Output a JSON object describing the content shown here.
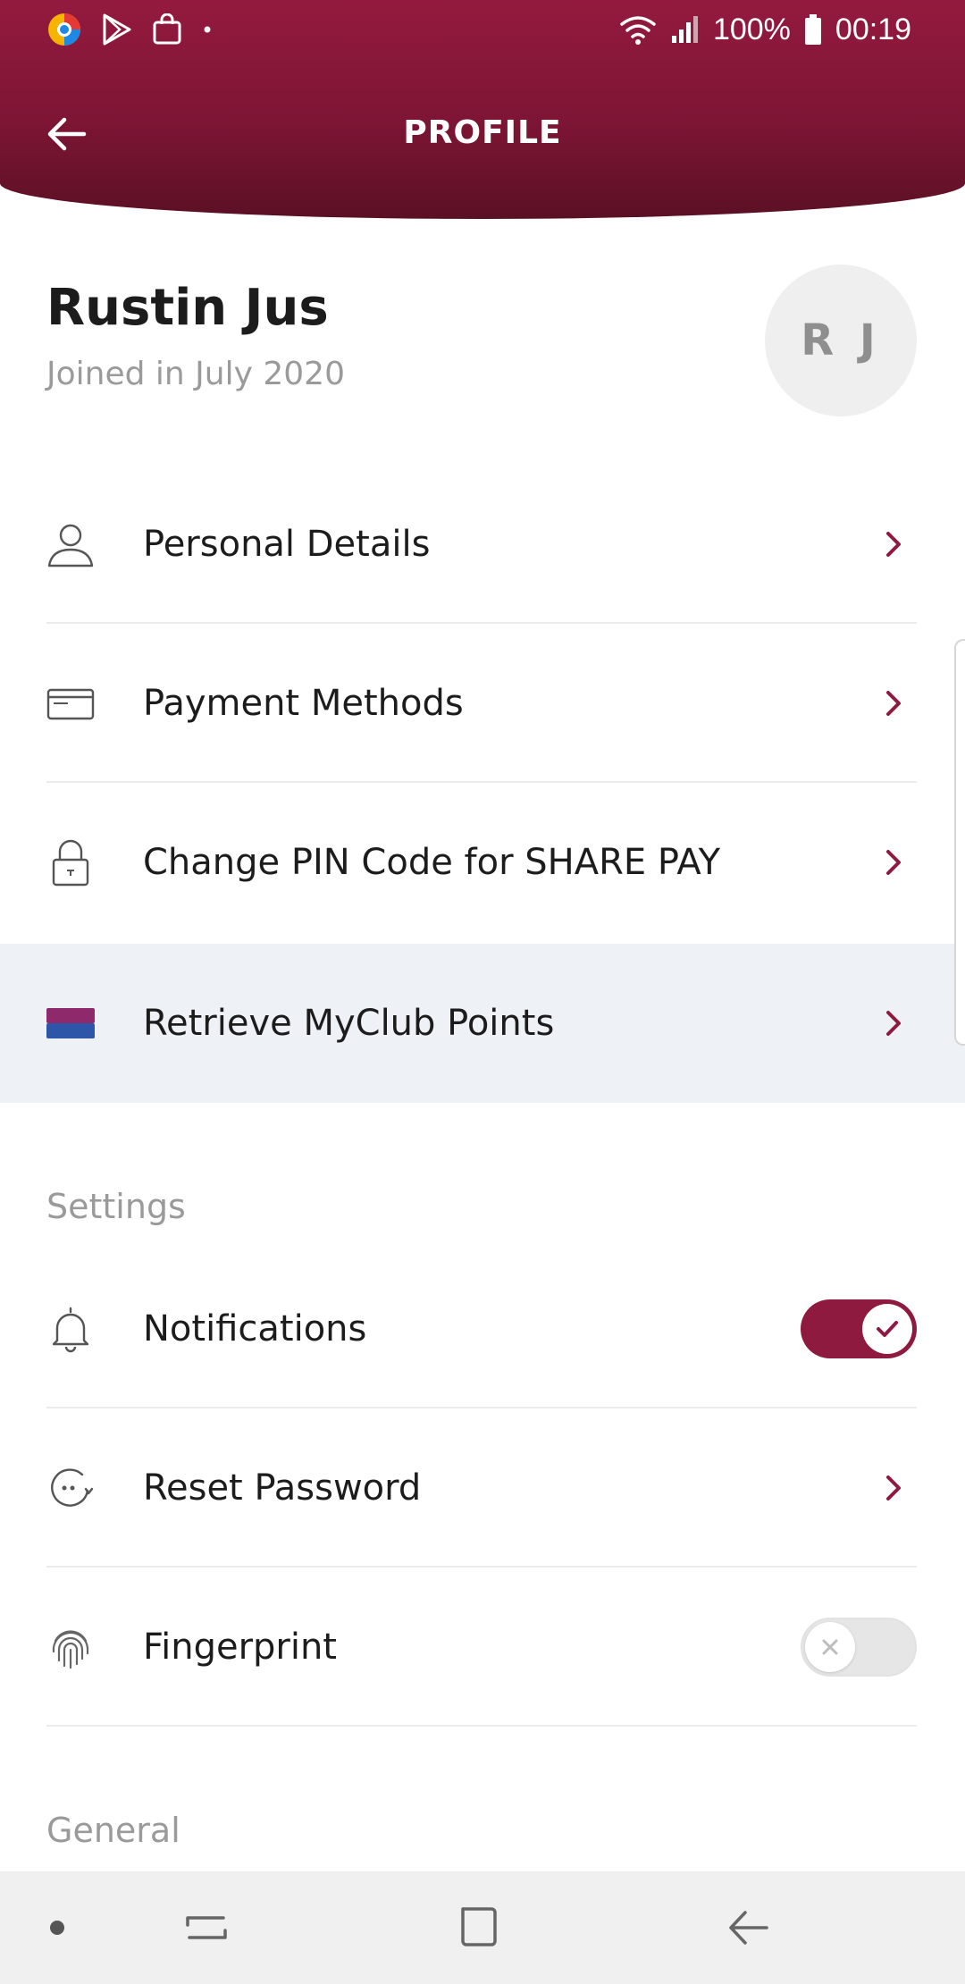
{
  "status_bar": {
    "battery_percent": "100%",
    "time": "00:19"
  },
  "header": {
    "title": "PROFILE"
  },
  "profile": {
    "name": "Rustin Jus",
    "joined": "Joined in July 2020",
    "initials": "R J"
  },
  "account_items": [
    {
      "label": "Personal Details",
      "icon": "person-icon"
    },
    {
      "label": "Payment Methods",
      "icon": "credit-card-icon"
    },
    {
      "label": "Change PIN Code for SHARE PAY",
      "icon": "lock-icon"
    },
    {
      "label": "Retrieve MyClub Points",
      "icon": "myclub-card-icon"
    }
  ],
  "settings": {
    "section_title": "Settings",
    "notifications_label": "Notifications",
    "notifications_on": true,
    "reset_password_label": "Reset Password",
    "fingerprint_label": "Fingerprint",
    "fingerprint_on": false
  },
  "general": {
    "section_title": "General"
  },
  "colors": {
    "brand": "#8e1a3f",
    "highlight_row": "#eef2f7",
    "myclub_top": "#8e2a6b",
    "myclub_bottom": "#2d55a8"
  }
}
